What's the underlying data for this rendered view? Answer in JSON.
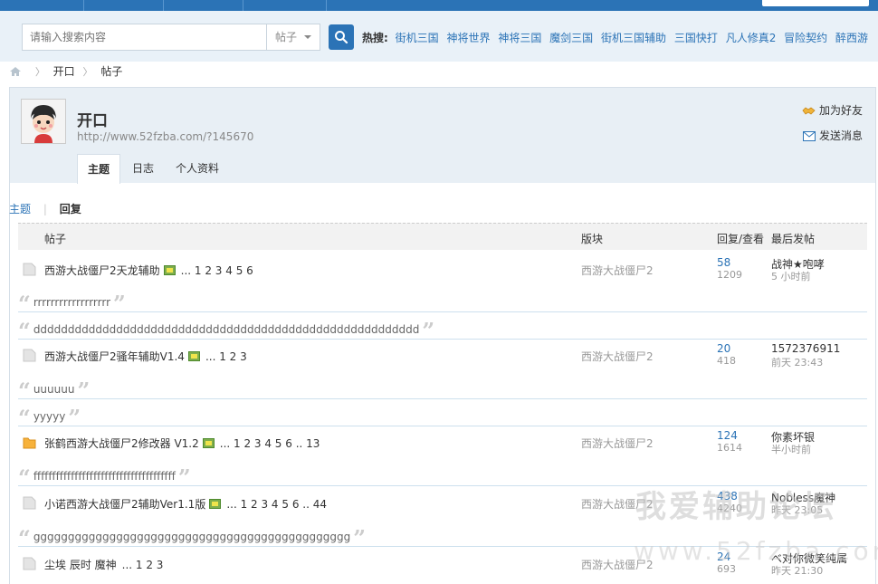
{
  "search": {
    "placeholder": "请输入搜索内容",
    "type": "帖子",
    "hot_label": "热搜:",
    "hot_terms": [
      "街机三国",
      "神将世界",
      "神将三国",
      "魔剑三国",
      "街机三国辅助",
      "三国快打",
      "凡人修真2",
      "冒险契约",
      "醉西游"
    ]
  },
  "breadcrumb": {
    "level1": "开口",
    "level2": "帖子"
  },
  "profile": {
    "name": "开口",
    "url": "http://www.52fzba.com/?145670",
    "add_friend": "加为好友",
    "send_message": "发送消息",
    "tabs": [
      "主题",
      "日志",
      "个人资料"
    ]
  },
  "subtabs": {
    "topics": "主题",
    "replies": "回复"
  },
  "table": {
    "headers": {
      "title": "帖子",
      "forum": "版块",
      "stats": "回复/查看",
      "last": "最后发帖"
    },
    "rows": [
      {
        "title": "西游大战僵尸2天龙辅助",
        "pages": "... 1 2 3 4 5 6",
        "forum": "西游大战僵尸2",
        "replies": "58",
        "views": "1209",
        "last_user": "战神★咆哮",
        "last_time": "5 小时前",
        "quotes": [
          "rrrrrrrrrrrrrrrrrr",
          "dddddddddddddddddddddddddddddddddddddddddddddddddddddddd"
        ]
      },
      {
        "title": "西游大战僵尸2骚年辅助V1.4",
        "pages": "... 1 2 3",
        "forum": "西游大战僵尸2",
        "replies": "20",
        "views": "418",
        "last_user": "1572376911",
        "last_time": "前天 23:43",
        "quotes": [
          "uuuuuu",
          "yyyyy"
        ]
      },
      {
        "title": "张鹤西游大战僵尸2修改器 V1.2",
        "pages": "... 1 2 3 4 5 6 .. 13",
        "forum": "西游大战僵尸2",
        "replies": "124",
        "views": "1614",
        "last_user": "你素坏银",
        "last_time": "半小时前",
        "quotes": [
          "ffffffffffffffffffffffffffffffffffffff"
        ]
      },
      {
        "title": "小诺西游大战僵尸2辅助Ver1.1版",
        "pages": "... 1 2 3 4 5 6 .. 44",
        "forum": "西游大战僵尸2",
        "replies": "438",
        "views": "4240",
        "last_user": "Nobless魔神",
        "last_time": "昨天 23:05",
        "quotes": [
          "gggggggggggggggggggggggggggggggggggggggggggggg"
        ]
      },
      {
        "title": "尘埃 辰时 魔神",
        "pages": "... 1 2 3",
        "forum": "西游大战僵尸2",
        "replies": "24",
        "views": "693",
        "last_user": "べ对你微笑纯属",
        "last_time": "昨天 21:30",
        "quotes": []
      }
    ]
  },
  "watermark": {
    "line1": "我爱辅助论坛",
    "line2": "www.52fzba.com"
  },
  "colors": {
    "accent": "#2b73b6",
    "header_bg": "#e9f1f8",
    "profile_bg": "#e8eff5"
  }
}
